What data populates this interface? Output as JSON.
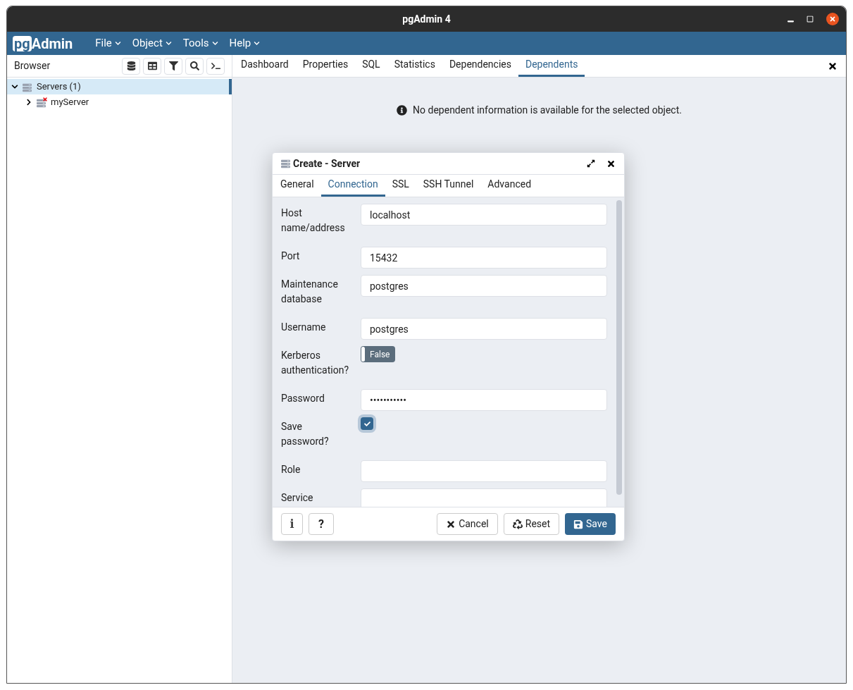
{
  "window": {
    "title": "pgAdmin 4"
  },
  "logo": {
    "boxed": "pg",
    "rest": "Admin"
  },
  "menu": [
    "File",
    "Object",
    "Tools",
    "Help"
  ],
  "browser": {
    "title": "Browser",
    "tree": [
      {
        "label": "Servers (1)",
        "selected": true,
        "expanded": true,
        "children": [
          {
            "label": "myServer",
            "selected": false,
            "expanded": false,
            "disconnected": true
          }
        ]
      }
    ]
  },
  "tabs": [
    {
      "label": "Dashboard",
      "selected": false
    },
    {
      "label": "Properties",
      "selected": false
    },
    {
      "label": "SQL",
      "selected": false
    },
    {
      "label": "Statistics",
      "selected": false
    },
    {
      "label": "Dependencies",
      "selected": false
    },
    {
      "label": "Dependents",
      "selected": true
    }
  ],
  "message": "No dependent information is available for the selected object.",
  "dialog": {
    "title": "Create - Server",
    "tabs": [
      {
        "label": "General",
        "selected": false
      },
      {
        "label": "Connection",
        "selected": true
      },
      {
        "label": "SSL",
        "selected": false
      },
      {
        "label": "SSH Tunnel",
        "selected": false
      },
      {
        "label": "Advanced",
        "selected": false
      }
    ],
    "fields": [
      {
        "kind": "text",
        "label": "Host name/address",
        "value": "localhost"
      },
      {
        "kind": "text",
        "label": "Port",
        "value": "15432"
      },
      {
        "kind": "text",
        "label": "Maintenance database",
        "value": "postgres"
      },
      {
        "kind": "text",
        "label": "Username",
        "value": "postgres"
      },
      {
        "kind": "switch",
        "label": "Kerberos authentication?",
        "on": false,
        "text": "False"
      },
      {
        "kind": "text",
        "label": "Password",
        "value": "•••••••••••"
      },
      {
        "kind": "checkbox",
        "label": "Save password?",
        "checked": true
      },
      {
        "kind": "text",
        "label": "Role"
      },
      {
        "kind": "text",
        "label": "Service"
      }
    ],
    "info_button": "i",
    "help_button": "?",
    "buttons": [
      {
        "kind": "cancel",
        "label": "Cancel"
      },
      {
        "kind": "reset",
        "label": "Reset"
      },
      {
        "kind": "save",
        "label": "Save"
      }
    ]
  }
}
